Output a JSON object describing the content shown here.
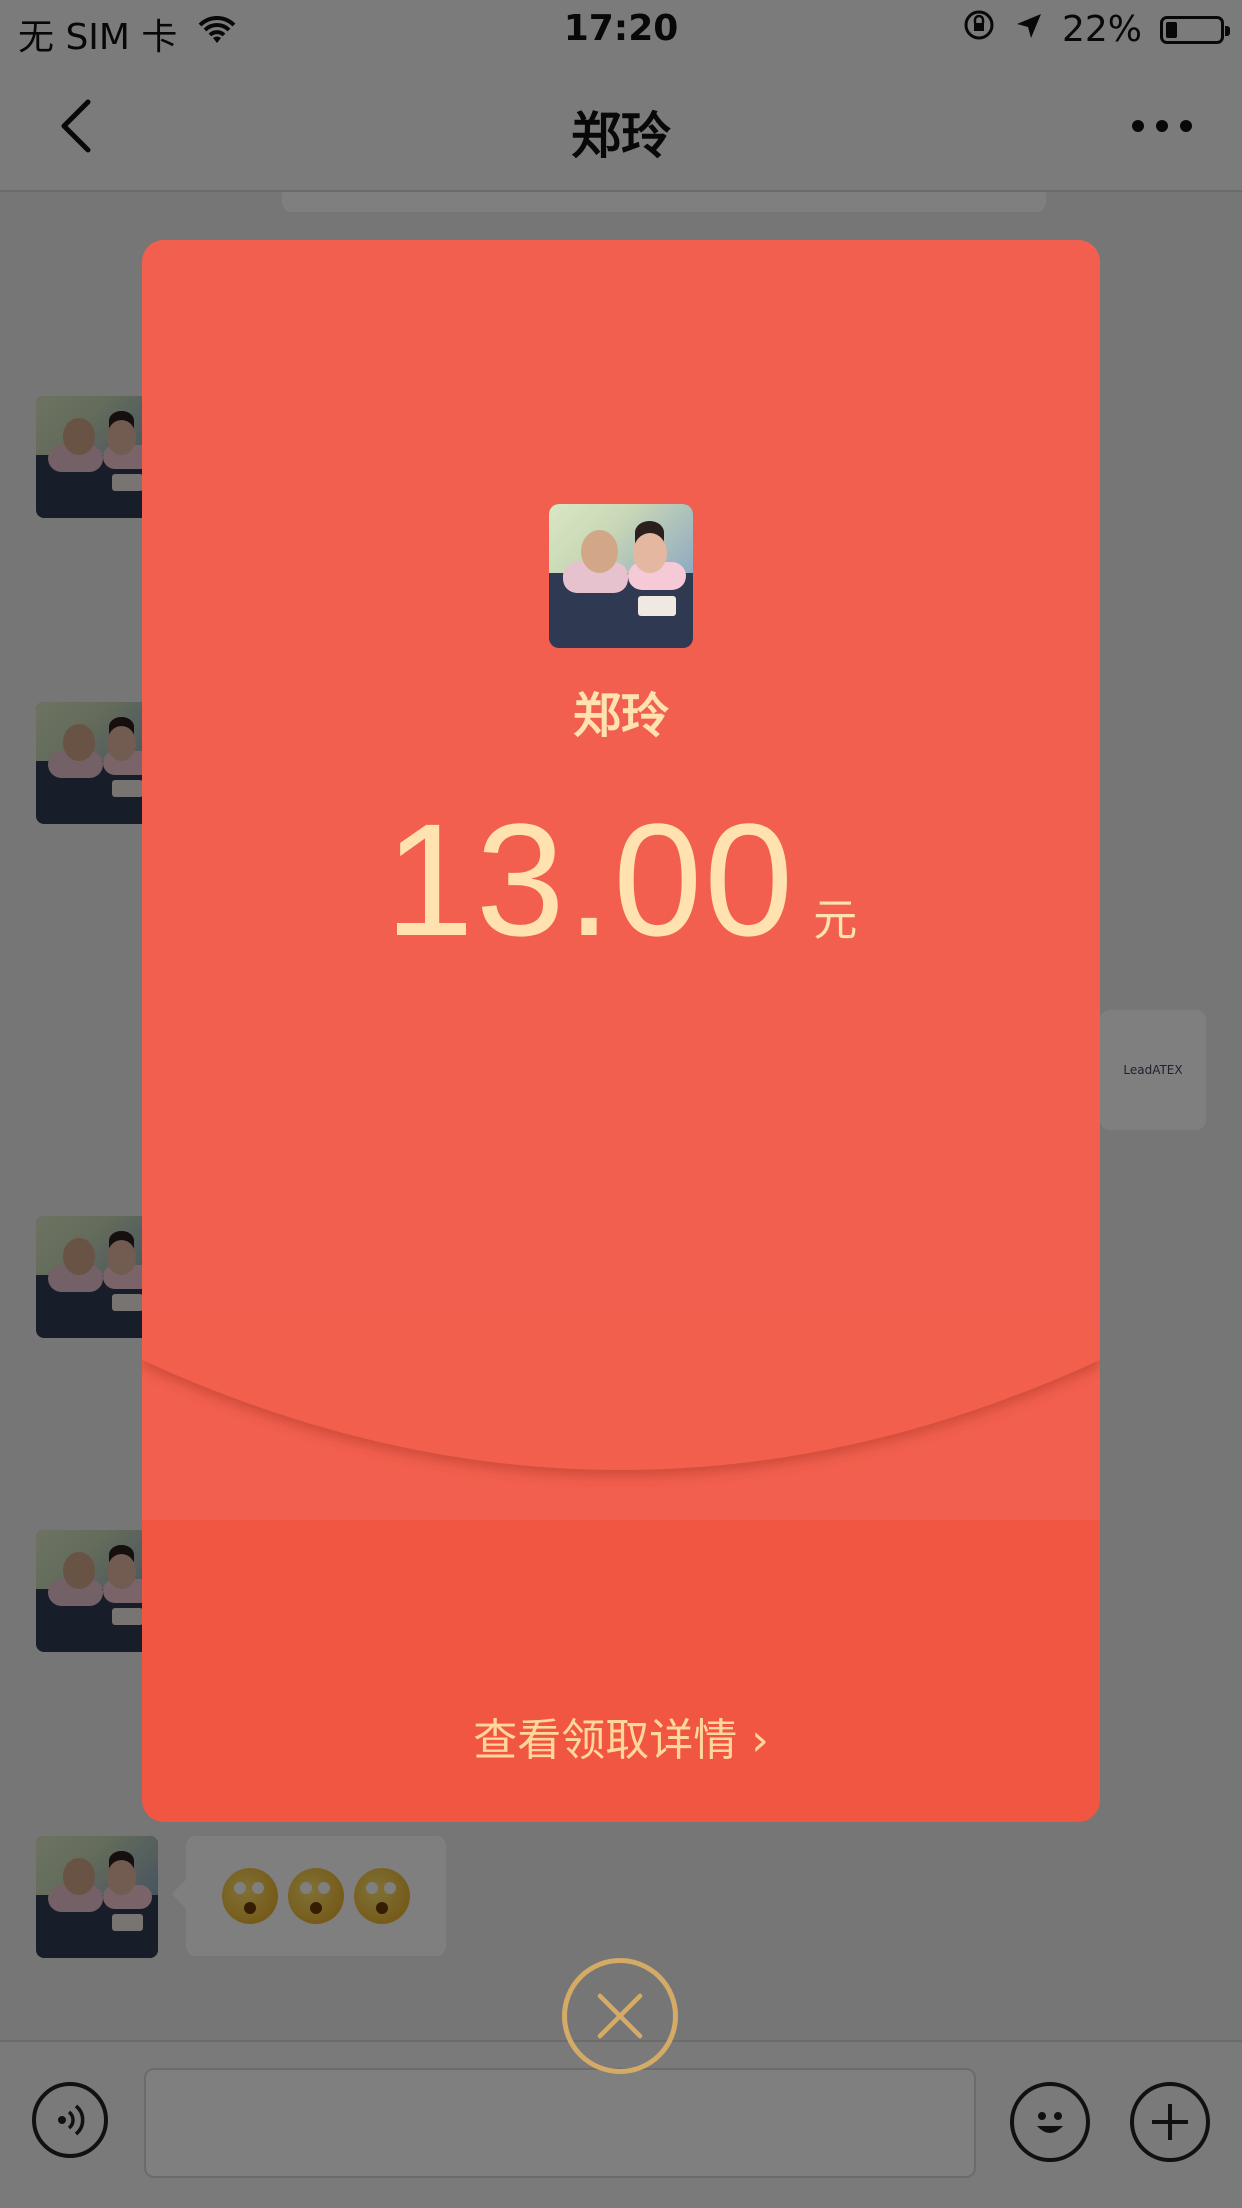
{
  "status_bar": {
    "carrier": "无 SIM 卡",
    "time": "17:20",
    "battery_text": "22%",
    "battery_level": 0.22,
    "icons": [
      "wifi-icon",
      "orientation-lock-icon",
      "location-arrow-icon",
      "battery-icon"
    ]
  },
  "nav": {
    "title": "郑玲",
    "back_icon": "chevron-left-icon",
    "more_icon": "ellipsis-icon"
  },
  "chat": {
    "emoji_message": [
      "dizzy-face-emoji",
      "dizzy-face-emoji",
      "dizzy-face-emoji"
    ],
    "card_text": "LeadATEX"
  },
  "input_bar": {
    "voice_icon": "voice-icon",
    "emoji_icon": "smile-icon",
    "plus_icon": "plus-icon"
  },
  "red_packet": {
    "sender_name": "郑玲",
    "amount": "13.00",
    "unit": "元",
    "detail_link": "查看领取详情 ›",
    "colors": {
      "packet_top": "#f25f4e",
      "packet_bottom": "#f15642",
      "gold_text": "#ffe2b0",
      "close_ring": "#d3aa66"
    }
  },
  "close_button": {
    "icon": "close-icon"
  }
}
